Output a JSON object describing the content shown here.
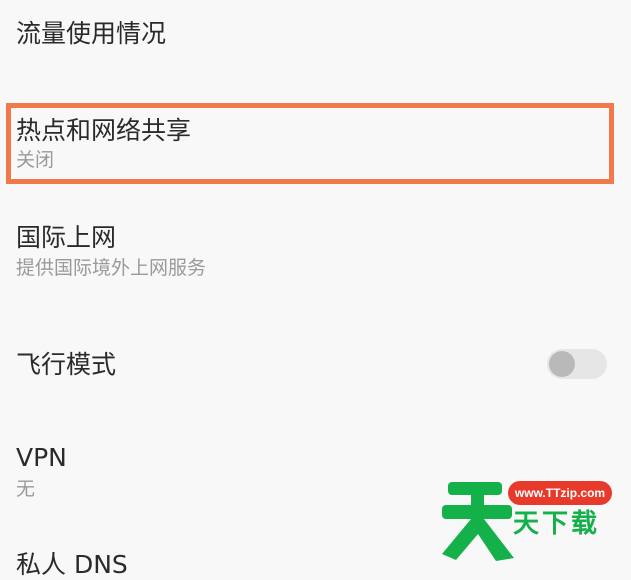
{
  "settings": {
    "data_usage": {
      "title": "流量使用情况"
    },
    "hotspot": {
      "title": "热点和网络共享",
      "subtitle": "关闭"
    },
    "international": {
      "title": "国际上网",
      "subtitle": "提供国际境外上网服务"
    },
    "airplane": {
      "title": "飞行模式",
      "toggle_on": false
    },
    "vpn": {
      "title": "VPN",
      "subtitle": "无"
    },
    "private_dns": {
      "title": "私人 DNS"
    }
  },
  "highlight": {
    "color": "#f07a4e"
  },
  "watermark": {
    "url": "www.TTzip.com",
    "brand": "天下载",
    "logo_char": "天",
    "colors": {
      "green": "#14b04a",
      "red": "#e83a2a"
    }
  }
}
